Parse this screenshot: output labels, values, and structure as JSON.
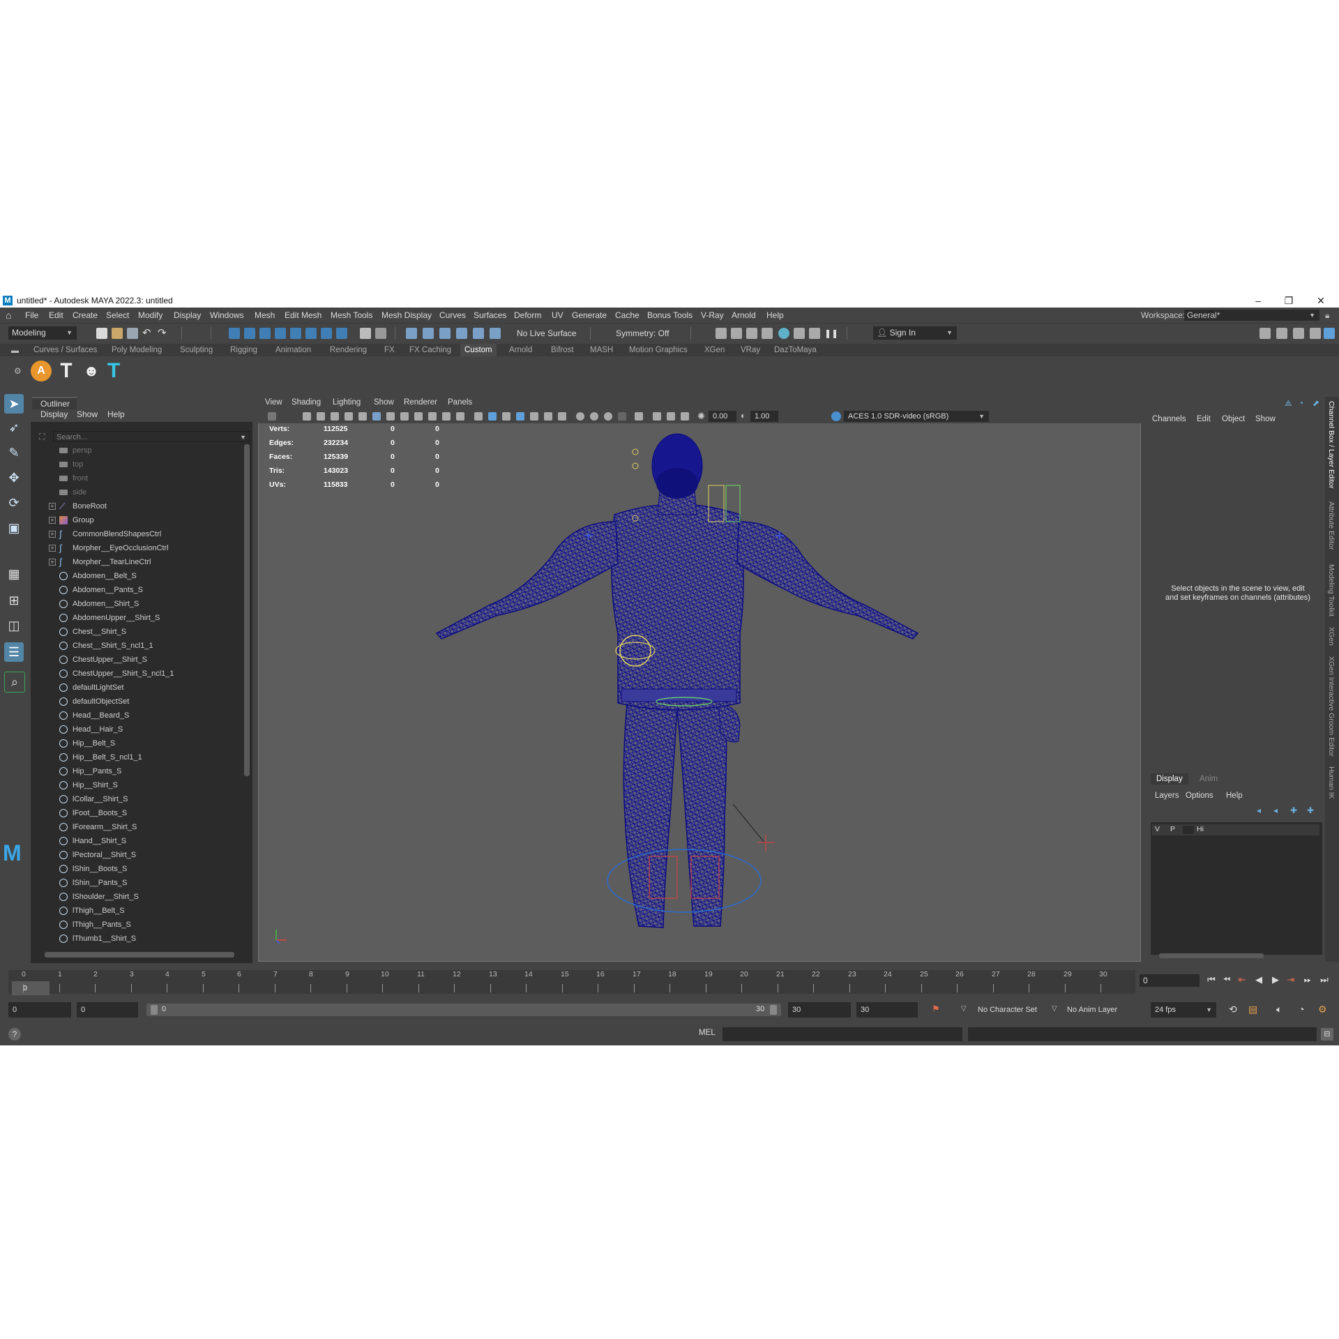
{
  "window": {
    "title": "untitled* - Autodesk MAYA 2022.3: untitled",
    "logo_letter": "M",
    "controls": [
      "–",
      "❐",
      "✕"
    ]
  },
  "menubar": {
    "items": [
      "File",
      "Edit",
      "Create",
      "Select",
      "Modify",
      "Display",
      "Windows",
      "Mesh",
      "Edit Mesh",
      "Mesh Tools",
      "Mesh Display",
      "Curves",
      "Surfaces",
      "Deform",
      "UV",
      "Generate",
      "Cache",
      "Bonus Tools",
      "V-Ray",
      "Arnold",
      "Help"
    ],
    "workspace_label": "Workspace:",
    "workspace_value": "General*"
  },
  "statusline": {
    "mode": "Modeling",
    "live_surface": "No Live Surface",
    "symmetry": "Symmetry: Off",
    "sign_in": "Sign In"
  },
  "shelf": {
    "tabs": [
      "Curves / Surfaces",
      "Poly Modeling",
      "Sculpting",
      "Rigging",
      "Animation",
      "Rendering",
      "FX",
      "FX Caching",
      "Custom",
      "Arnold",
      "Bifrost",
      "MASH",
      "Motion Graphics",
      "XGen",
      "VRay",
      "DazToMaya"
    ],
    "active_tab": "Custom",
    "arnold_glyph": "A"
  },
  "outliner": {
    "tab": "Outliner",
    "menus": [
      "Display",
      "Show",
      "Help"
    ],
    "search_placeholder": "Search...",
    "items": [
      {
        "label": "persp",
        "icon": "camera-icon",
        "dim": true,
        "expand": false
      },
      {
        "label": "top",
        "icon": "camera-icon",
        "dim": true,
        "expand": false
      },
      {
        "label": "front",
        "icon": "camera-icon",
        "dim": true,
        "expand": false
      },
      {
        "label": "side",
        "icon": "camera-icon",
        "dim": true,
        "expand": false
      },
      {
        "label": "BoneRoot",
        "icon": "joint-icon",
        "dim": false,
        "expand": true
      },
      {
        "label": "Group",
        "icon": "group-icon",
        "dim": false,
        "expand": true
      },
      {
        "label": "CommonBlendShapesCtrl",
        "icon": "curve-icon",
        "dim": false,
        "expand": true
      },
      {
        "label": "Morpher__EyeOcclusionCtrl",
        "icon": "curve-icon",
        "dim": false,
        "expand": true
      },
      {
        "label": "Morpher__TearLineCtrl",
        "icon": "curve-icon",
        "dim": false,
        "expand": true
      },
      {
        "label": "Abdomen__Belt_S",
        "icon": "set-icon",
        "dim": false,
        "expand": false
      },
      {
        "label": "Abdomen__Pants_S",
        "icon": "set-icon",
        "dim": false,
        "expand": false
      },
      {
        "label": "Abdomen__Shirt_S",
        "icon": "set-icon",
        "dim": false,
        "expand": false
      },
      {
        "label": "AbdomenUpper__Shirt_S",
        "icon": "set-icon",
        "dim": false,
        "expand": false
      },
      {
        "label": "Chest__Shirt_S",
        "icon": "set-icon",
        "dim": false,
        "expand": false
      },
      {
        "label": "Chest__Shirt_S_ncl1_1",
        "icon": "set-icon",
        "dim": false,
        "expand": false
      },
      {
        "label": "ChestUpper__Shirt_S",
        "icon": "set-icon",
        "dim": false,
        "expand": false
      },
      {
        "label": "ChestUpper__Shirt_S_ncl1_1",
        "icon": "set-icon",
        "dim": false,
        "expand": false
      },
      {
        "label": "defaultLightSet",
        "icon": "set-icon",
        "dim": false,
        "expand": false
      },
      {
        "label": "defaultObjectSet",
        "icon": "set-icon",
        "dim": false,
        "expand": false
      },
      {
        "label": "Head__Beard_S",
        "icon": "set-icon",
        "dim": false,
        "expand": false
      },
      {
        "label": "Head__Hair_S",
        "icon": "set-icon",
        "dim": false,
        "expand": false
      },
      {
        "label": "Hip__Belt_S",
        "icon": "set-icon",
        "dim": false,
        "expand": false
      },
      {
        "label": "Hip__Belt_S_ncl1_1",
        "icon": "set-icon",
        "dim": false,
        "expand": false
      },
      {
        "label": "Hip__Pants_S",
        "icon": "set-icon",
        "dim": false,
        "expand": false
      },
      {
        "label": "Hip__Shirt_S",
        "icon": "set-icon",
        "dim": false,
        "expand": false
      },
      {
        "label": "lCollar__Shirt_S",
        "icon": "set-icon",
        "dim": false,
        "expand": false
      },
      {
        "label": "lFoot__Boots_S",
        "icon": "set-icon",
        "dim": false,
        "expand": false
      },
      {
        "label": "lForearm__Shirt_S",
        "icon": "set-icon",
        "dim": false,
        "expand": false
      },
      {
        "label": "lHand__Shirt_S",
        "icon": "set-icon",
        "dim": false,
        "expand": false
      },
      {
        "label": "lPectoral__Shirt_S",
        "icon": "set-icon",
        "dim": false,
        "expand": false
      },
      {
        "label": "lShin__Boots_S",
        "icon": "set-icon",
        "dim": false,
        "expand": false
      },
      {
        "label": "lShin__Pants_S",
        "icon": "set-icon",
        "dim": false,
        "expand": false
      },
      {
        "label": "lShoulder__Shirt_S",
        "icon": "set-icon",
        "dim": false,
        "expand": false
      },
      {
        "label": "lThigh__Belt_S",
        "icon": "set-icon",
        "dim": false,
        "expand": false
      },
      {
        "label": "lThigh__Pants_S",
        "icon": "set-icon",
        "dim": false,
        "expand": false
      },
      {
        "label": "lThumb1__Shirt_S",
        "icon": "set-icon",
        "dim": false,
        "expand": false
      }
    ]
  },
  "viewport": {
    "menus": [
      "View",
      "Shading",
      "Lighting",
      "Show",
      "Renderer",
      "Panels"
    ],
    "exposure": "0.00",
    "gamma": "1.00",
    "color_space": "ACES 1.0 SDR-video (sRGB)",
    "hud": [
      {
        "label": "Verts:",
        "values": [
          "112525",
          "0",
          "0"
        ]
      },
      {
        "label": "Edges:",
        "values": [
          "232234",
          "0",
          "0"
        ]
      },
      {
        "label": "Faces:",
        "values": [
          "125339",
          "0",
          "0"
        ]
      },
      {
        "label": "Tris:",
        "values": [
          "143023",
          "0",
          "0"
        ]
      },
      {
        "label": "UVs:",
        "values": [
          "115833",
          "0",
          "0"
        ]
      }
    ]
  },
  "channelbox": {
    "menus": [
      "Channels",
      "Edit",
      "Object",
      "Show"
    ],
    "hint": "Select objects in the scene to view, edit and set keyframes on channels (attributes)",
    "layer_tabs": [
      "Display",
      "Anim"
    ],
    "active_layer_tab": "Display",
    "layer_menus": [
      "Layers",
      "Options",
      "Help"
    ],
    "layer_row": {
      "v": "V",
      "p": "P",
      "name": "Hi"
    }
  },
  "side_tabs": [
    "Channel Box / Layer Editor",
    "Attribute Editor",
    "Modeling Toolkit",
    "XGen",
    "XGen Interactive Groom Editor",
    "Human IK"
  ],
  "timeline": {
    "ticks": [
      "0",
      "1",
      "2",
      "3",
      "4",
      "5",
      "6",
      "7",
      "8",
      "9",
      "10",
      "11",
      "12",
      "13",
      "14",
      "15",
      "16",
      "17",
      "18",
      "19",
      "20",
      "21",
      "22",
      "23",
      "24",
      "25",
      "26",
      "27",
      "28",
      "29",
      "30"
    ],
    "current_frame_marker": "0",
    "current_frame": "0"
  },
  "range": {
    "start": "0",
    "playback_start": "0",
    "slider_start": "0",
    "slider_end": "30",
    "playback_end": "30",
    "end": "30",
    "character_set": "No Character Set",
    "anim_layer": "No Anim Layer",
    "fps": "24 fps"
  },
  "command": {
    "language": "MEL"
  }
}
